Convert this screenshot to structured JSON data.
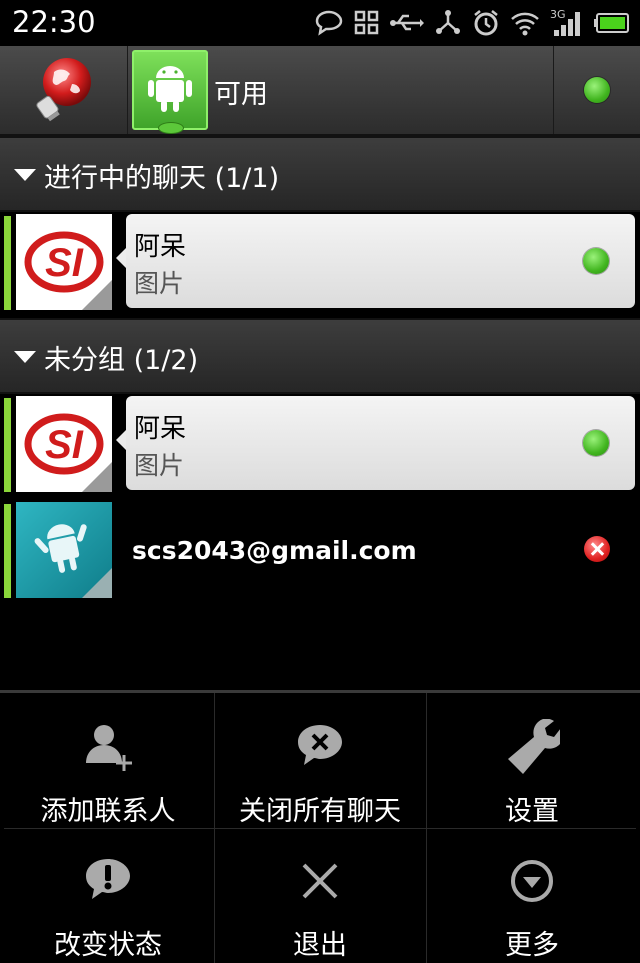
{
  "status_bar": {
    "time": "22:30",
    "signal_label": "3G",
    "icons": [
      "chat-icon",
      "grid-icon",
      "usb-icon",
      "share-icon",
      "alarm-icon",
      "wifi-icon",
      "signal-icon",
      "battery-icon"
    ]
  },
  "top_bar": {
    "logo_icon": "globe-bulb-icon",
    "avatar_icon": "android-icon",
    "status_text": "可用",
    "status_color": "#41b51f"
  },
  "groups": [
    {
      "title": "进行中的聊天 (1/1)",
      "contacts": [
        {
          "name": "阿呆",
          "status_text": "图片",
          "presence": "online"
        }
      ]
    },
    {
      "title": "未分组 (1/2)",
      "contacts": [
        {
          "name": "阿呆",
          "status_text": "图片",
          "presence": "online"
        },
        {
          "name": "scs2043@gmail.com",
          "status_text": "",
          "presence": "offline"
        }
      ]
    }
  ],
  "menu": {
    "items": [
      {
        "label": "添加联系人",
        "icon": "add-person-icon"
      },
      {
        "label": "关闭所有聊天",
        "icon": "close-chat-icon"
      },
      {
        "label": "设置",
        "icon": "wrench-icon"
      },
      {
        "label": "改变状态",
        "icon": "exclamation-icon"
      },
      {
        "label": "退出",
        "icon": "x-icon"
      },
      {
        "label": "更多",
        "icon": "more-icon"
      }
    ]
  }
}
